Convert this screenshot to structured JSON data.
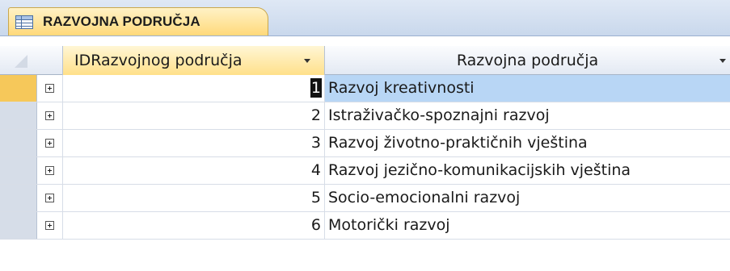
{
  "tab": {
    "title": "RAZVOJNA PODRUČJA",
    "icon": "table-icon"
  },
  "columns": {
    "id": "IDRazvojnog područja",
    "name": "Razvojna područja"
  },
  "rows": [
    {
      "id": "1",
      "name": "Razvoj kreativnosti"
    },
    {
      "id": "2",
      "name": "Istraživačko-spoznajni razvoj"
    },
    {
      "id": "3",
      "name": "Razvoj životno-praktičnih vještina"
    },
    {
      "id": "4",
      "name": "Razvoj jezično-komunikacijskih vještina"
    },
    {
      "id": "5",
      "name": "Socio-emocionalni razvoj"
    },
    {
      "id": "6",
      "name": "Motorički razvoj"
    }
  ],
  "colors": {
    "tab_bg": "#ffd97a",
    "selected_header": "#ffe08a",
    "current_row_selector": "#f6c85a",
    "current_row_cell": "#b8d6f5"
  }
}
